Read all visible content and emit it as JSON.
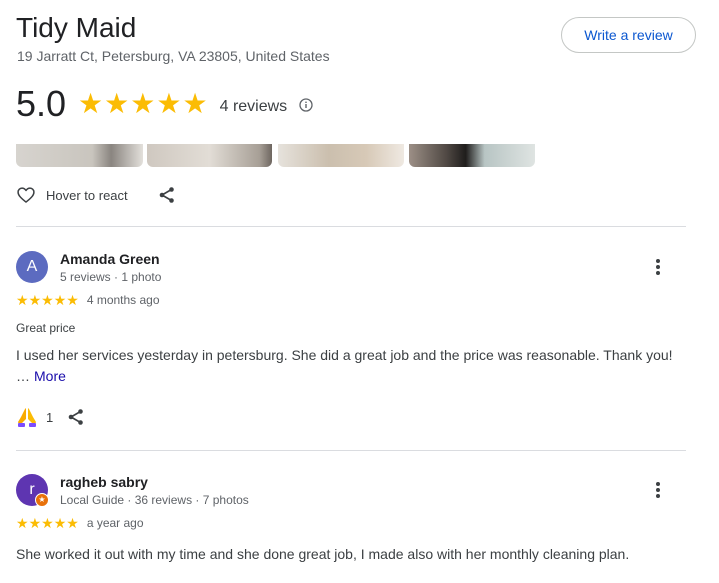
{
  "place": {
    "name": "Tidy Maid",
    "address": "19 Jarratt Ct, Petersburg, VA 23805, United States"
  },
  "actions": {
    "write_review_label": "Write a review",
    "hover_react_label": "Hover to react"
  },
  "rating": {
    "value": "5.0",
    "stars": 5,
    "review_count_text": "4 reviews"
  },
  "reviews": [
    {
      "avatar_letter": "A",
      "avatar_color": "#5c6bc0",
      "name": "Amanda Green",
      "meta": "5 reviews · 1 photo",
      "stars": 5,
      "time": "4 months ago",
      "title": "Great price",
      "text": "I used her services yesterday in petersburg. She did a great job and the price was reasonable. Thank you!",
      "more_prefix": "…",
      "more_label": "More",
      "reaction_count": "1"
    },
    {
      "avatar_letter": "r",
      "avatar_color": "#5e35b1",
      "name": "ragheb sabry",
      "meta": "Local Guide · 36 reviews · 7 photos",
      "stars": 5,
      "time": "a year ago",
      "text": "She worked it out with my time and she done great job, I made also with her monthly cleaning plan."
    }
  ],
  "colors": {
    "star": "#fbbc04",
    "link": "#0b57d0",
    "local_guide_badge": "#e8710a"
  }
}
